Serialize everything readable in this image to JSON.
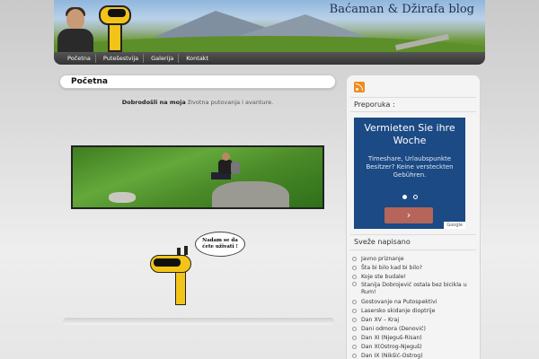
{
  "header": {
    "blog_title": "Baćaman & Džirafa blog"
  },
  "nav": {
    "items": [
      "Početna",
      "Putešestvija",
      "Galerija",
      "Kontakt"
    ]
  },
  "main": {
    "title": "Početna",
    "welcome_prefix": "Dobrodošli na moja",
    "welcome_link": "životna putovanja i avanture.",
    "cartoon_speech": "Nadam se da ćete uživati !"
  },
  "sidebar": {
    "message_heading": "Preporuka :",
    "ad": {
      "headline": "Vermieten Sie ihre Woche",
      "body": "Timeshare, Urlaubspunkte Besitzer? Keine versteckten Gebühren.",
      "button": "›",
      "badge": "Google"
    },
    "recent_heading": "Sveže napisano",
    "recent_posts": [
      "Javno priznanje",
      "Šta bi bilo kad bi bilo?",
      "Koje ste budale!",
      "Stanija Dobrojević ostala bez bicikla u Rum!",
      "Gostovanje na Putospektivi",
      "Lasersko skidanje dioptrije",
      "Dan XV – Kraj",
      "Dani odmora (Denović)",
      "Dan XI (Njeguš-Risan)",
      "Dan X(Ostrog-Njeguš)",
      "Dan IX (Nikšić-Ostrog)"
    ]
  }
}
